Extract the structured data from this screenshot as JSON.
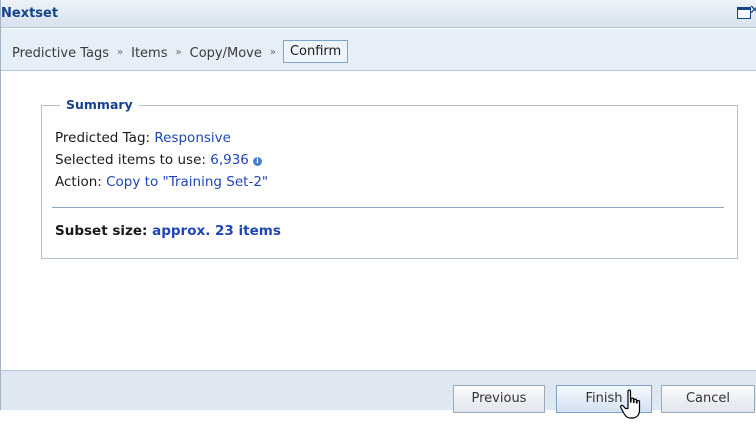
{
  "window": {
    "title": "Nextset"
  },
  "breadcrumb": {
    "items": [
      {
        "label": "Predictive Tags"
      },
      {
        "label": "Items"
      },
      {
        "label": "Copy/Move"
      },
      {
        "label": "Confirm"
      }
    ],
    "separator": "»",
    "active_index": 3
  },
  "summary": {
    "legend": "Summary",
    "predicted_tag_label": "Predicted Tag:",
    "predicted_tag_value": "Responsive",
    "selected_items_label": "Selected items to use:",
    "selected_items_value": "6,936",
    "action_label": "Action:",
    "action_value": "Copy to \"Training Set-2\"",
    "subset_size_label": "Subset size:",
    "subset_size_value": "approx. 23 items"
  },
  "footer": {
    "previous_label": "Previous",
    "finish_label": "Finish",
    "cancel_label": "Cancel"
  },
  "icons": {
    "maximize": "maximize-icon",
    "close": "close-icon",
    "info": "info-icon",
    "cursor": "hand-cursor-icon"
  },
  "colors": {
    "title_text": "#15428b",
    "value_link": "#1f45b8",
    "breadcrumb_bg": "#e6eef7",
    "footer_bg": "#dfe7f1"
  }
}
